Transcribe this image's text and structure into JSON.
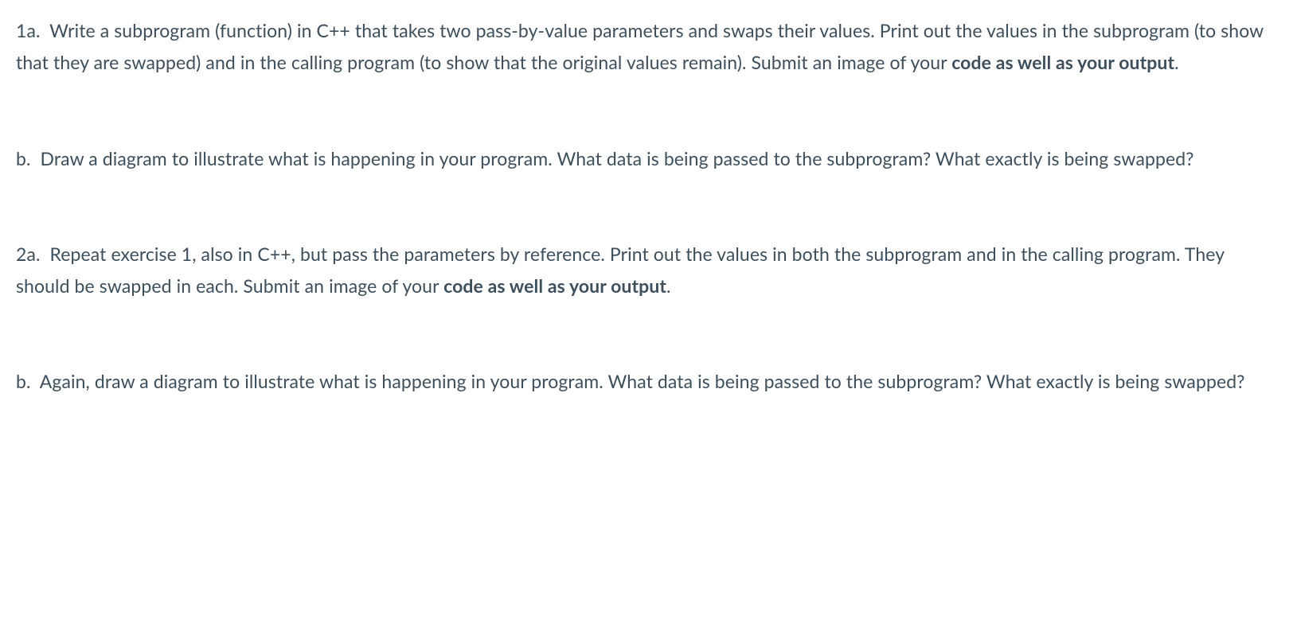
{
  "questions": [
    {
      "label": "1a.",
      "text_before_bold": "Write a subprogram (function) in C++ that takes two pass-by-value parameters and swaps their values. Print out the values in the subprogram (to show that they are swapped) and in the calling program (to show that the original values remain).  Submit an image of your ",
      "bold_text": "code as well as your output",
      "text_after_bold": "."
    },
    {
      "label": "b.",
      "text_before_bold": "Draw a diagram to illustrate what is happening in your program.  What data is being passed to the subprogram? What exactly is being swapped?",
      "bold_text": "",
      "text_after_bold": ""
    },
    {
      "label": "2a.",
      "text_before_bold": "Repeat exercise 1, also in C++, but pass the parameters by reference. Print out the values in both the subprogram and in the calling program.  They should be swapped in each.  Submit an image of your ",
      "bold_text": "code as well as your output",
      "text_after_bold": "."
    },
    {
      "label": "b.",
      "text_before_bold": "Again, draw a diagram to illustrate what is happening in your program.  What data is being passed to the subprogram?  What exactly is being swapped?",
      "bold_text": "",
      "text_after_bold": ""
    }
  ]
}
